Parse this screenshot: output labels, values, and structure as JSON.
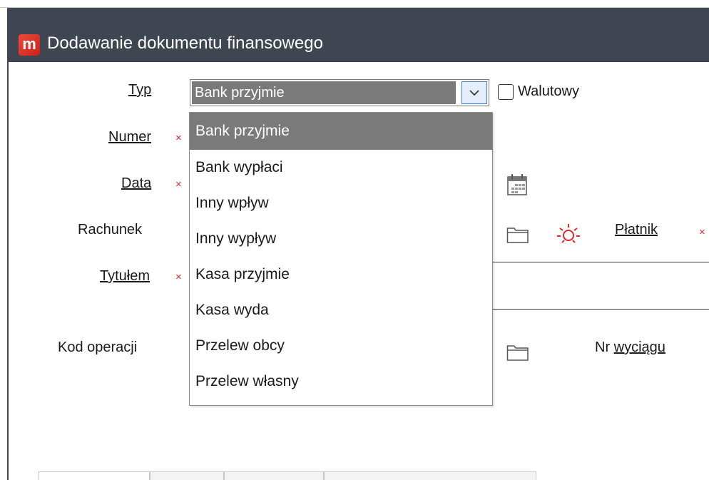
{
  "window": {
    "title": "Dodawanie dokumentu finansowego",
    "logo_letter": "m"
  },
  "labels": {
    "typ": "Typ",
    "numer": "Numer",
    "data": "Data",
    "rachunek": "Rachunek",
    "tytulem": "Tytułem",
    "kod_operacji": "Kod operacji",
    "platnik": "Płatnik",
    "nr_wyciagu_prefix": "Nr ",
    "nr_wyciagu_underlined": "wyciągu",
    "required_marker": "×"
  },
  "typ_select": {
    "value": "Bank przyjmie",
    "options": [
      "Bank przyjmie",
      "Bank wypłaci",
      "Inny wpływ",
      "Inny wypływ",
      "Kasa przyjmie",
      "Kasa wyda",
      "Przelew obcy",
      "Przelew własny"
    ],
    "selected_index": 0
  },
  "walutowy": {
    "label": "Walutowy",
    "checked": false
  },
  "icons": {
    "dropdown_arrow": "chevron-down-icon",
    "calendar": "calendar-icon",
    "rachunek_folder": "folder-icon",
    "refresh": "sun-refresh-icon",
    "kod_folder": "folder-icon"
  },
  "colors": {
    "titlebar": "#3f4652",
    "selection": "#7a7a7a",
    "required": "#e0262b",
    "logo": "#e0382c",
    "focus": "#3c7fd1"
  }
}
